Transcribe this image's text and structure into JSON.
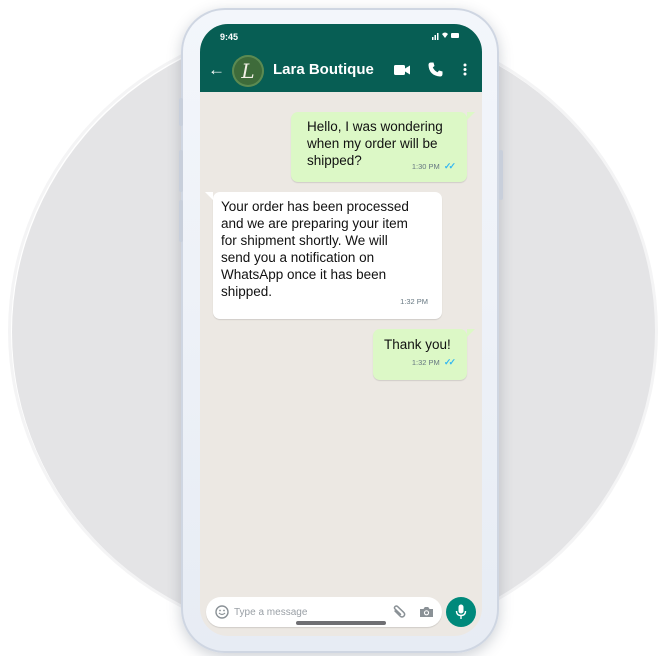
{
  "status_bar": {
    "time": "9:45",
    "icons_text": "‗ ▾ ▬"
  },
  "header": {
    "back_icon": "arrow-left-icon",
    "avatar_letter": "L",
    "contact_name": "Lara Boutique",
    "icons": [
      "video-call-icon",
      "voice-call-icon",
      "more-options-icon"
    ]
  },
  "messages": [
    {
      "direction": "outgoing",
      "lines": [
        "Hello, I was wondering",
        "when my order will be",
        "shipped?"
      ],
      "time": "1:30 PM",
      "ticks": "✓✓"
    },
    {
      "direction": "incoming",
      "lines": [
        "Your order has been processed",
        "and we are preparing your item",
        "for shipment shortly. We will",
        "send you a notification on",
        "WhatsApp once it has been",
        "shipped."
      ],
      "time": "1:32 PM"
    },
    {
      "direction": "outgoing",
      "lines": [
        "Thank you!"
      ],
      "time": "1:32 PM",
      "ticks": "✓✓"
    }
  ],
  "composer": {
    "placeholder": "Type a message",
    "value": "",
    "icons": [
      "emoji-icon",
      "paperclip-icon",
      "camera-icon",
      "microphone-icon"
    ]
  },
  "colors": {
    "header": "#075e54",
    "outgoing_bubble": "#dcf8c6",
    "incoming_bubble": "#ffffff",
    "chat_background": "#ece8e3",
    "read_ticks": "#34b7f1",
    "mic_button": "#00897b"
  }
}
